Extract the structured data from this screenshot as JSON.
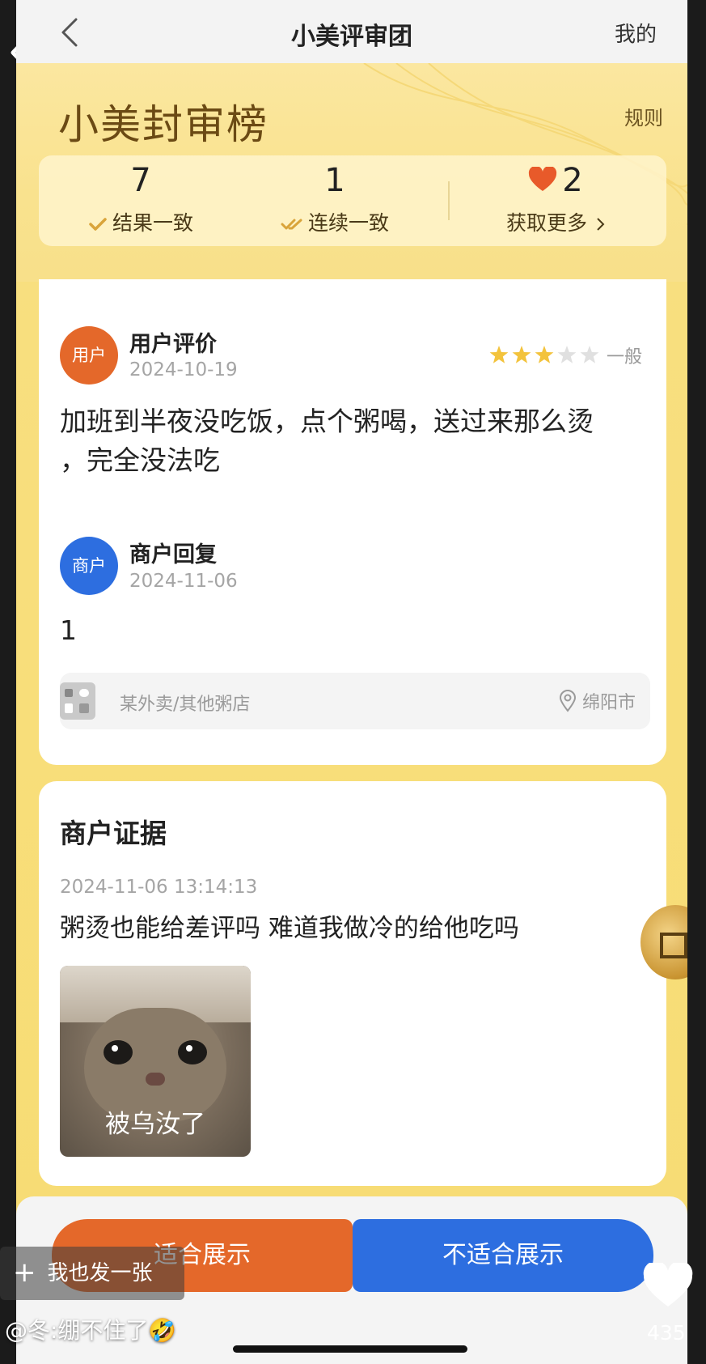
{
  "nav": {
    "title": "小美评审团",
    "right": "我的"
  },
  "hero": {
    "title": "小美封审榜",
    "rule": "规则",
    "stats": [
      {
        "num": "7",
        "label": "结果一致"
      },
      {
        "num": "1",
        "label": "连续一致"
      },
      {
        "num": "2",
        "label": "获取更多"
      }
    ]
  },
  "review": {
    "avatar": "用户",
    "name": "用户评价",
    "date": "2024-10-19",
    "rating": 3,
    "rating_max": 5,
    "rating_label": "一般",
    "text_line1": "加班到半夜没吃饭，点个粥喝，送过来那么烫",
    "text_line2": "，完全没法吃"
  },
  "reply": {
    "avatar": "商户",
    "name": "商户回复",
    "date": "2024-11-06",
    "text": "1"
  },
  "shop": {
    "name": "某外卖/其他粥店",
    "city": "绵阳市"
  },
  "evidence": {
    "title": "商户证据",
    "datetime": "2024-11-06 13:14:13",
    "text": "粥烫也能给差评吗 难道我做冷的给他吃吗",
    "meme_caption": "被乌汝了"
  },
  "buttons": {
    "fit": "适合展示",
    "unfit": "不适合展示"
  },
  "overlay": {
    "post": "我也发一张",
    "comment": "@冬:绷不住了🤣",
    "likes": "435"
  },
  "colors": {
    "orange": "#e4682a",
    "blue": "#2d6ee0",
    "star": "#f3c33c"
  }
}
